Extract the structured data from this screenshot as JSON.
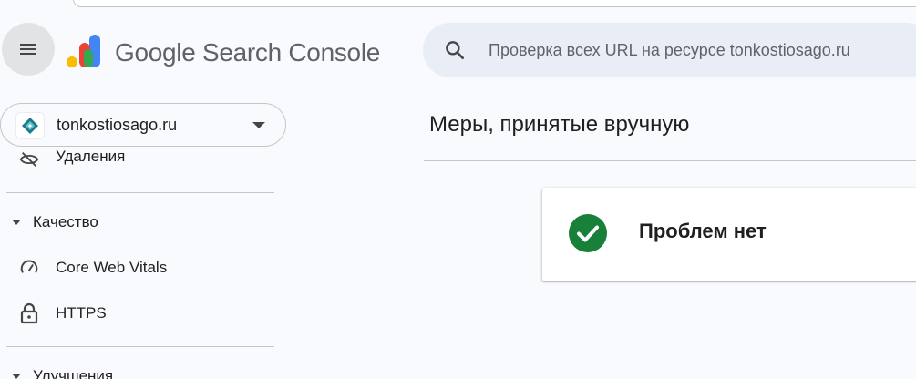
{
  "header": {
    "product_brand": "Google",
    "product_name": "Search Console",
    "search_placeholder": "Проверка всех URL на ресурсе tonkostiosago.ru"
  },
  "property": {
    "name": "tonkostiosago.ru"
  },
  "sidebar": {
    "partial_item_label": "Удаления",
    "sections": [
      {
        "label": "Качество",
        "items": [
          {
            "label": "Core Web Vitals",
            "icon": "speedometer-icon"
          },
          {
            "label": "HTTPS",
            "icon": "lock-icon"
          }
        ]
      },
      {
        "label": "Улучшения"
      }
    ]
  },
  "main": {
    "title": "Меры, принятые вручную",
    "status": "Проблем нет"
  },
  "colors": {
    "background": "#f8fafd",
    "search_bg": "#e9eef6",
    "success_green": "#188038",
    "logo_blue": "#4285f4",
    "logo_red": "#ea4335",
    "logo_yellow": "#fbbc04",
    "logo_green": "#34a853"
  }
}
